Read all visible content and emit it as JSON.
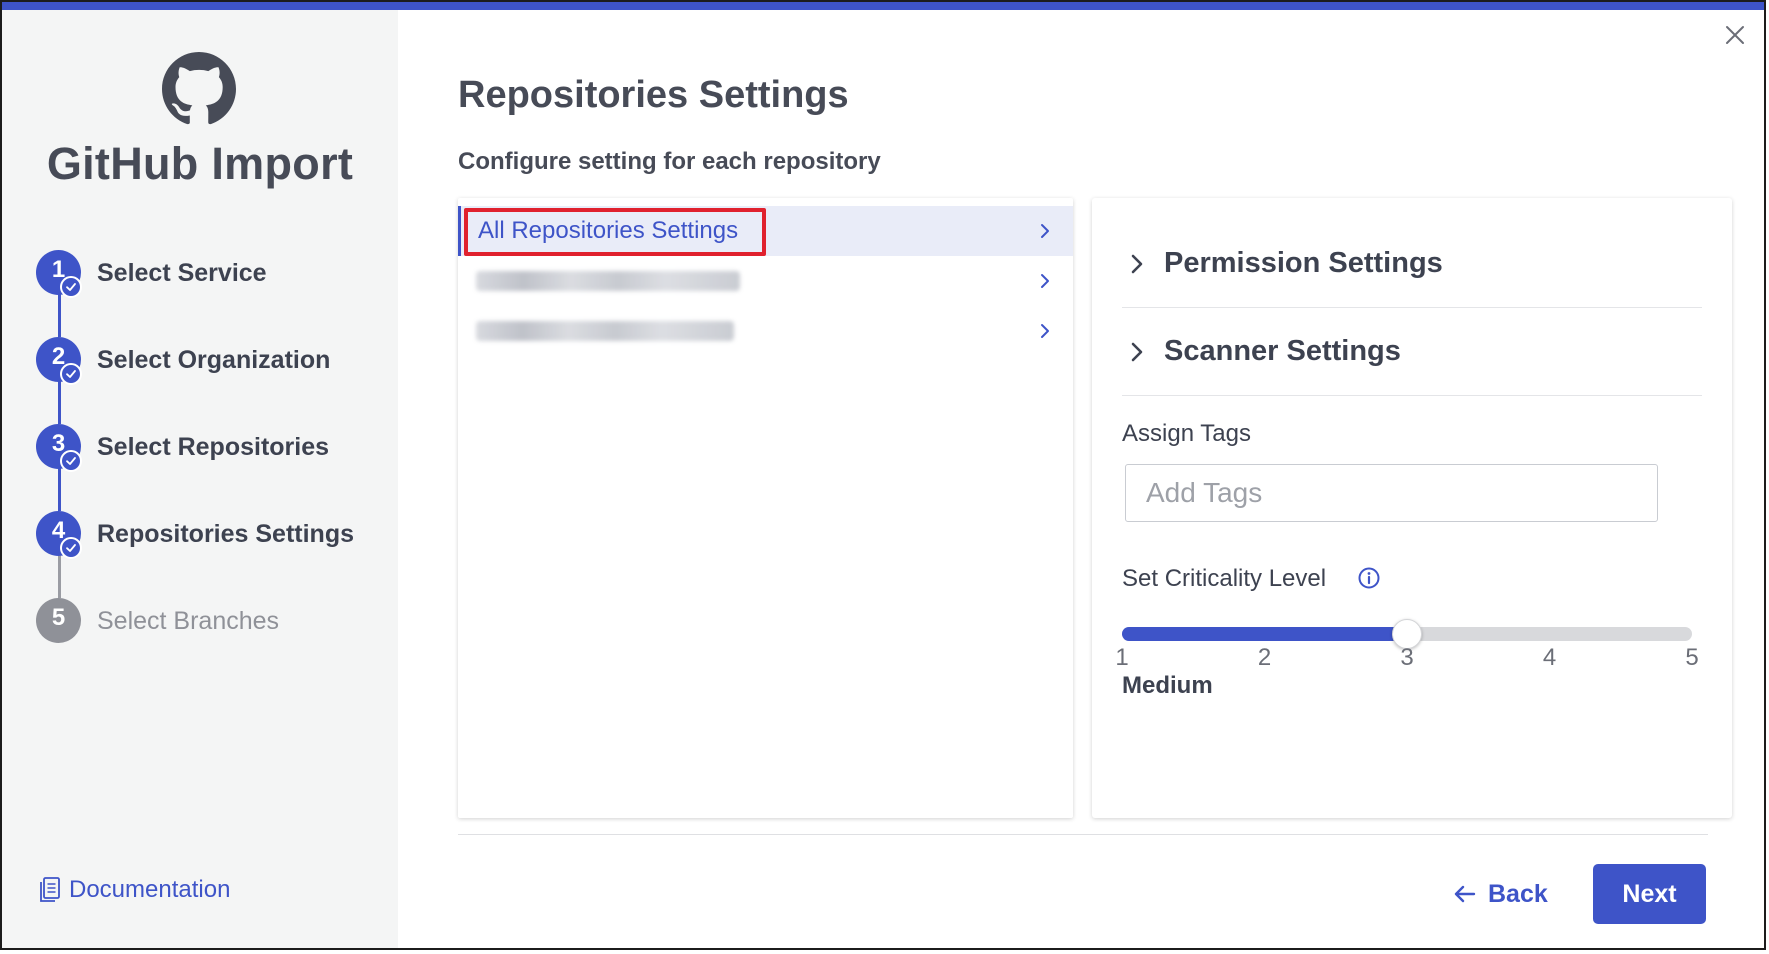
{
  "app": {
    "title": "GitHub Import",
    "logo_icon": "github-icon",
    "accent_color": "#3e54c8",
    "highlight_color": "#e0212e"
  },
  "steps": [
    {
      "number": "1",
      "label": "Select Service",
      "status": "completed"
    },
    {
      "number": "2",
      "label": "Select Organization",
      "status": "completed"
    },
    {
      "number": "3",
      "label": "Select Repositories",
      "status": "completed"
    },
    {
      "number": "4",
      "label": "Repositories Settings",
      "status": "current"
    },
    {
      "number": "5",
      "label": "Select Branches",
      "status": "pending"
    }
  ],
  "sidebar": {
    "documentation_label": "Documentation",
    "documentation_icon": "document-icon"
  },
  "main": {
    "title": "Repositories Settings",
    "subtitle": "Configure setting for each repository"
  },
  "repositories": {
    "items": [
      {
        "label": "All Repositories Settings",
        "selected": true,
        "redacted": false
      },
      {
        "label": "",
        "selected": false,
        "redacted": true
      },
      {
        "label": "",
        "selected": false,
        "redacted": true
      }
    ]
  },
  "settings": {
    "sections": [
      {
        "label": "Permission Settings",
        "expanded": false
      },
      {
        "label": "Scanner Settings",
        "expanded": false
      }
    ],
    "tags": {
      "label": "Assign Tags",
      "placeholder": "Add Tags",
      "value": ""
    },
    "criticality": {
      "label": "Set Criticality Level",
      "info_icon": "info-icon",
      "min": 1,
      "max": 5,
      "value": 3,
      "ticks": [
        "1",
        "2",
        "3",
        "4",
        "5"
      ],
      "value_label": "Medium"
    }
  },
  "footer": {
    "back_label": "Back",
    "next_label": "Next"
  }
}
